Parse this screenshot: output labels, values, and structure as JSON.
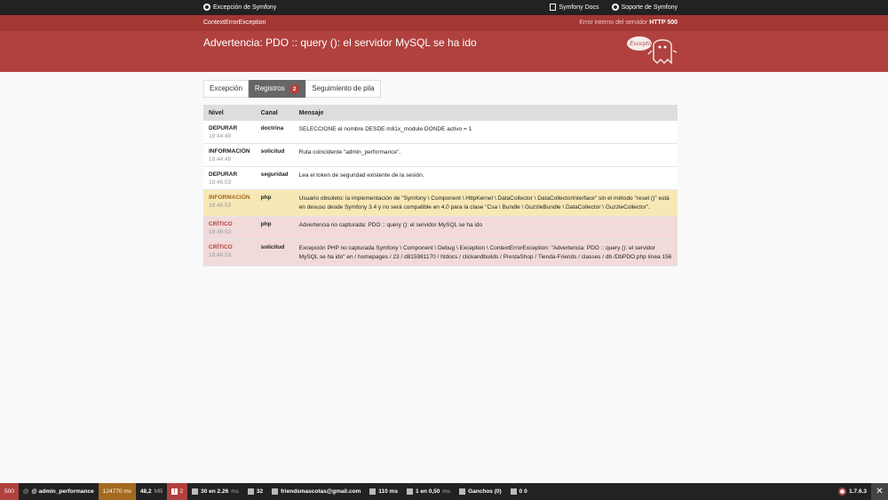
{
  "topbar": {
    "brand": "Excepción de Symfony",
    "links": [
      "Symfony Docs",
      "Soporte de Symfony"
    ]
  },
  "header": {
    "exception_class": "ContextErrorException",
    "status_text": "Error interno del servidor",
    "status_code": "HTTP 500",
    "title": "Advertencia: PDO :: query (): el servidor MySQL se ha ido",
    "ghost_text": "Exception"
  },
  "tabs": {
    "exception": "Excepción",
    "logs": "Registros",
    "logs_count": "2",
    "trace": "Seguimiento de pila"
  },
  "table": {
    "headers": {
      "level": "Nivel",
      "channel": "Canal",
      "message": "Mensaje"
    },
    "rows": [
      {
        "level": "DEPURAR",
        "time": "18:44:48",
        "channel": "doctrina",
        "message": "SELECCIONE el nombre DESDE m81x_module DONDE activo = 1"
      },
      {
        "level": "INFORMACIÓN",
        "time": "18:44:48",
        "channel": "solicitud",
        "message": "Ruta coincidente \"admin_performance\"."
      },
      {
        "level": "DEPURAR",
        "time": "18:46:53",
        "channel": "seguridad",
        "message": "Lea el token de seguridad existente de la sesión."
      },
      {
        "level": "INFORMACIÓN",
        "time": "18:46:53",
        "channel": "php",
        "message": "Usuario obsoleto: la implementación de \"Symfony \\ Component \\ HttpKernel \\ DataCollector \\ DataCollectorInterface\" sin el método \"reset ()\" está en desuso desde Symfony 3.4 y no será compatible en 4.0 para la clase \"Csa \\ Bundle \\ GuzzleBundle \\ DataCollector \\ GuzzleCollector\"."
      },
      {
        "level": "CRÍTICO",
        "time": "18:46:53",
        "channel": "php",
        "message": "Advertencia no capturada: PDO :: query (): el servidor MySQL se ha ido"
      },
      {
        "level": "CRÍTICO",
        "time": "18:46:53",
        "channel": "solicitud",
        "message": "Excepción PHP no capturada Symfony \\ Component \\ Debug \\ Exception \\ ContextErrorException: \"Advertencia: PDO :: query (): el servidor MySQL se ha ido\" en / homepages / 23 / d815981170 / htdocs / clickandbuilds / PrestaShop / Tienda-Friends / classes / db /DbPDO.php línea 156"
      }
    ]
  },
  "toolbar": {
    "status_code": "500",
    "route_prefix": "@",
    "route": "@ admin_performance",
    "time": "124770 ms",
    "memory": "48,2",
    "memory_unit": "MB",
    "errors": "2",
    "cache": "30 en 2.26",
    "cache_unit": "ms",
    "requests": "32",
    "user": "friendsmascotas@gmail.com",
    "twig": "110 ms",
    "db": "1 en 0,50",
    "db_unit": "ms",
    "guzzle": "Ganchos (0)",
    "other": "0 0",
    "version": "1.7.6.3",
    "close": "✕"
  },
  "colors": {
    "danger": "#b0413e",
    "warning_bg": "#f7e8b6",
    "critical_bg": "#f2dada"
  }
}
